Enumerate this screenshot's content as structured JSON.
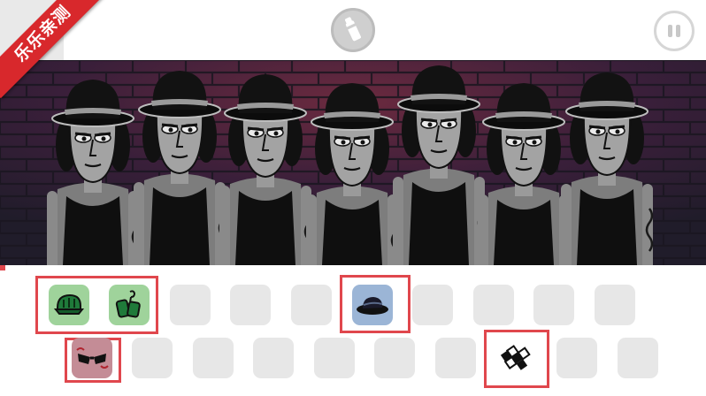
{
  "watermark": {
    "text": "乐乐亲测",
    "color": "#d8282c"
  },
  "toolbar": {
    "left_block_color": "#e9e9e9",
    "spray_icon": "spray-can-icon",
    "pause_icon": "pause-icon"
  },
  "stage": {
    "background": "brick-wall",
    "characters": [
      {
        "id": 1
      },
      {
        "id": 2
      },
      {
        "id": 3
      },
      {
        "id": 4
      },
      {
        "id": 5
      },
      {
        "id": 6
      },
      {
        "id": 7
      }
    ]
  },
  "tray": {
    "row1": [
      {
        "state": "filled",
        "icon": "cap-icon",
        "color": "#9fd39b"
      },
      {
        "state": "filled",
        "icon": "bags-icon",
        "color": "#9fd39b"
      },
      {
        "state": "empty"
      },
      {
        "state": "empty"
      },
      {
        "state": "empty"
      },
      {
        "state": "filled",
        "icon": "hat-icon",
        "color": "#9bb5d6"
      },
      {
        "state": "empty"
      },
      {
        "state": "empty"
      },
      {
        "state": "empty"
      },
      {
        "state": "empty"
      }
    ],
    "row2": [
      {
        "state": "filled",
        "icon": "glasses-icon",
        "color": "#c48c96"
      },
      {
        "state": "empty"
      },
      {
        "state": "empty"
      },
      {
        "state": "empty"
      },
      {
        "state": "empty"
      },
      {
        "state": "empty"
      },
      {
        "state": "empty"
      },
      {
        "state": "filled",
        "icon": "blocks-icon",
        "color": "#ffffff"
      },
      {
        "state": "empty"
      },
      {
        "state": "empty"
      }
    ],
    "highlight_color": "#e0474d"
  }
}
